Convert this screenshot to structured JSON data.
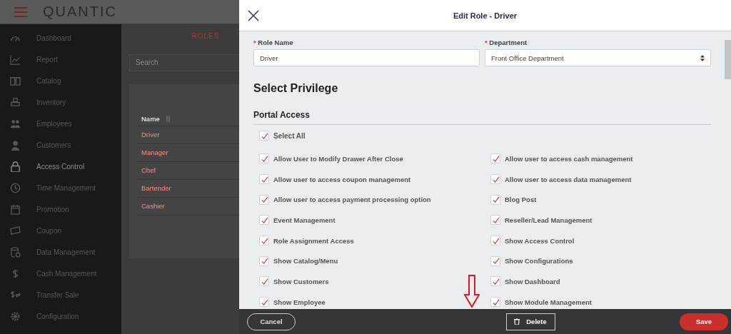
{
  "app": {
    "logo": "QUANTIC",
    "sidebar": {
      "items": [
        {
          "label": "Dashboard",
          "selected": false
        },
        {
          "label": "Report",
          "selected": false
        },
        {
          "label": "Catalog",
          "selected": false
        },
        {
          "label": "Inventory",
          "selected": false
        },
        {
          "label": "Employees",
          "selected": false
        },
        {
          "label": "Customers",
          "selected": false
        },
        {
          "label": "Access Control",
          "selected": true
        },
        {
          "label": "Time Management",
          "selected": false
        },
        {
          "label": "Promotion",
          "selected": false
        },
        {
          "label": "Coupon",
          "selected": false
        },
        {
          "label": "Data Management",
          "selected": false
        },
        {
          "label": "Cash Management",
          "selected": false
        },
        {
          "label": "Transfer Sale",
          "selected": false
        },
        {
          "label": "Configuration",
          "selected": false
        }
      ]
    },
    "page_title": "ROLES",
    "search": {
      "placeholder": "Search"
    },
    "table": {
      "columns": [
        "Name"
      ],
      "rows": [
        "Driver",
        "Manager",
        "Chef",
        "Bartender",
        "Cashier"
      ]
    }
  },
  "dialog": {
    "title": "Edit Role - Driver",
    "fields": [
      {
        "label": "Role Name",
        "required_mark": "*",
        "kind": "text",
        "value": "Driver"
      },
      {
        "label": "Department",
        "required_mark": "*",
        "kind": "select",
        "value": "Front Office Department"
      }
    ],
    "heading": "Select Privilege",
    "section": "Portal Access",
    "select_all": {
      "label": "Select All",
      "checked": true
    },
    "privileges": [
      {
        "label": "Allow User to Modify Drawer After Close",
        "checked": true
      },
      {
        "label": "Allow user to access cash management",
        "checked": true
      },
      {
        "label": "Allow user to access coupon management",
        "checked": true
      },
      {
        "label": "Allow user to access data management",
        "checked": true
      },
      {
        "label": "Allow user to access payment processing option",
        "checked": true
      },
      {
        "label": "Blog Post",
        "checked": true
      },
      {
        "label": "Event Management",
        "checked": true
      },
      {
        "label": "Reseller/Lead Management",
        "checked": true
      },
      {
        "label": "Role Assignment Access",
        "checked": true
      },
      {
        "label": "Show Access Control",
        "checked": true
      },
      {
        "label": "Show Catalog/Menu",
        "checked": true
      },
      {
        "label": "Show Configurations",
        "checked": true
      },
      {
        "label": "Show Customers",
        "checked": true
      },
      {
        "label": "Show Dashboard",
        "checked": true
      },
      {
        "label": "Show Employee",
        "checked": true
      },
      {
        "label": "Show Module Management",
        "checked": true
      }
    ],
    "buttons": {
      "cancel": "Cancel",
      "delete": "Delete",
      "save": "Save"
    }
  }
}
